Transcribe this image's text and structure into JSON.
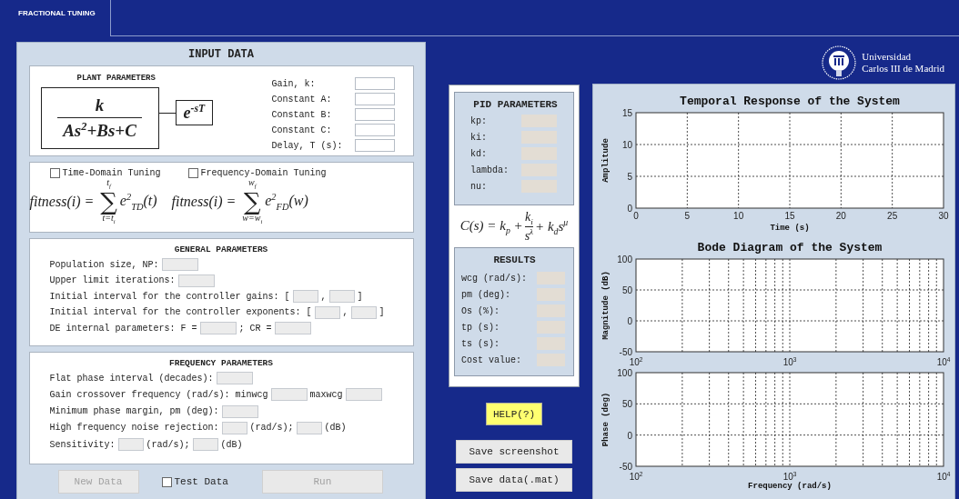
{
  "tab": {
    "label": "FRACTIONAL TUNING",
    "selected": true
  },
  "input_data": {
    "title": "INPUT DATA",
    "plant_parameters": {
      "title": "PLANT PARAMETERS",
      "numerator": "k",
      "denominator": "As$^{2}$+Bs+C",
      "delay": "e$^{-sT}$",
      "fields": [
        {
          "label": "Gain, k:",
          "disabled": false
        },
        {
          "label": "Constant A:",
          "disabled": false
        },
        {
          "label": "Constant B:",
          "disabled": false
        },
        {
          "label": "Constant C:",
          "disabled": false
        },
        {
          "label": "Delay, T (s):",
          "disabled": false
        }
      ]
    },
    "tuning": [
      {
        "label": "Time-Domain Tuning",
        "checked": false,
        "formula": {
          "lhs": "fitness(i) =",
          "upper": "t$_{f}$",
          "sum": "∑",
          "lower": "t=t$_{i}$",
          "term": "e$^{2}$$_{TD}$(t)"
        }
      },
      {
        "label": "Frequency-Domain Tuning",
        "checked": false,
        "formula": {
          "lhs": "fitness(i) =",
          "upper": "w$_{f}$",
          "sum": "∑",
          "lower": "w=w$_{i}$",
          "term": "e$^{2}$$_{FD}$(w)"
        }
      }
    ],
    "general_parameters": {
      "title": "GENERAL PARAMETERS",
      "rows": [
        {
          "items": [
            {
              "kind": "text",
              "text": "Population size, NP:"
            },
            {
              "kind": "field",
              "disabled": true
            }
          ]
        },
        {
          "items": [
            {
              "kind": "text",
              "text": "Upper limit iterations:"
            },
            {
              "kind": "field",
              "disabled": true
            }
          ]
        },
        {
          "items": [
            {
              "kind": "text",
              "text": "Initial interval for the controller gains: ["
            },
            {
              "kind": "field",
              "disabled": true
            },
            {
              "kind": "text",
              "text": ","
            },
            {
              "kind": "field",
              "disabled": true
            },
            {
              "kind": "text",
              "text": "]"
            }
          ]
        },
        {
          "items": [
            {
              "kind": "text",
              "text": "Initial interval for the controller exponents: ["
            },
            {
              "kind": "field",
              "disabled": true
            },
            {
              "kind": "text",
              "text": ","
            },
            {
              "kind": "field",
              "disabled": true
            },
            {
              "kind": "text",
              "text": "]"
            }
          ]
        },
        {
          "items": [
            {
              "kind": "text",
              "text": "DE internal parameters: F ="
            },
            {
              "kind": "field",
              "disabled": true
            },
            {
              "kind": "text",
              "text": "; CR ="
            },
            {
              "kind": "field",
              "disabled": true
            }
          ]
        }
      ]
    },
    "frequency_parameters": {
      "title": "FREQUENCY PARAMETERS",
      "rows": [
        {
          "items": [
            {
              "kind": "text",
              "text": "Flat phase interval (decades):"
            },
            {
              "kind": "field",
              "disabled": true
            }
          ]
        },
        {
          "items": [
            {
              "kind": "text",
              "text": "Gain crossover frequency (rad/s): minwcg"
            },
            {
              "kind": "field",
              "disabled": true
            },
            {
              "kind": "text",
              "text": "maxwcg"
            },
            {
              "kind": "field",
              "disabled": true
            }
          ]
        },
        {
          "items": [
            {
              "kind": "text",
              "text": "Minimum phase margin, pm (deg):"
            },
            {
              "kind": "field",
              "disabled": true
            }
          ]
        },
        {
          "items": [
            {
              "kind": "text",
              "text": "High frequency noise rejection:"
            },
            {
              "kind": "field",
              "disabled": true
            },
            {
              "kind": "text",
              "text": "(rad/s);"
            },
            {
              "kind": "field",
              "disabled": true
            },
            {
              "kind": "text",
              "text": "(dB)"
            }
          ]
        },
        {
          "items": [
            {
              "kind": "text",
              "text": "Sensitivity:"
            },
            {
              "kind": "field",
              "disabled": true
            },
            {
              "kind": "text",
              "text": "(rad/s);"
            },
            {
              "kind": "field",
              "disabled": true
            },
            {
              "kind": "text",
              "text": "(dB)"
            }
          ]
        }
      ]
    },
    "controls": [
      {
        "kind": "button",
        "label": "New Data",
        "disabled": true
      },
      {
        "kind": "checkbox",
        "label": "Test Data",
        "checked": false
      },
      {
        "kind": "button",
        "label": "Run",
        "disabled": true
      }
    ]
  },
  "pid_parameters": {
    "title": "PID PARAMETERS",
    "rows": [
      {
        "label": "kp:"
      },
      {
        "label": "ki:"
      },
      {
        "label": "kd:"
      },
      {
        "label": "lambda:"
      },
      {
        "label": "nu:"
      }
    ]
  },
  "controller_formula": {
    "lhs": "C(s) = k$_{p}$ +",
    "numerator": "k$_{i}$",
    "denominator": "s$^{λ}$",
    "rhs": "+ k$_{d}$s$^{μ}$"
  },
  "results": {
    "title": "RESULTS",
    "rows": [
      {
        "label": "wcg (rad/s):"
      },
      {
        "label": "pm (deg):"
      },
      {
        "label": "Os (%):"
      },
      {
        "label": "tp (s):"
      },
      {
        "label": "ts (s):"
      },
      {
        "label": "Cost value:"
      }
    ]
  },
  "help_button": {
    "label": "HELP(?)"
  },
  "save_buttons": [
    "Save screenshot",
    "Save data(.mat)"
  ],
  "logo": {
    "line_1": "Universidad",
    "line_2": "Carlos III de Madrid"
  },
  "charts": [
    {
      "chart_data": {
        "type": "line",
        "title": "Temporal Response of the System",
        "xlabel": "Time (s)",
        "ylabel": "Amplitude",
        "grid": true,
        "xlim": [
          0,
          30
        ],
        "ylim": [
          0,
          15
        ],
        "xticks": [
          0,
          5,
          10,
          15,
          20,
          25,
          30
        ],
        "yticks": [
          0,
          5,
          10,
          15
        ]
      }
    },
    {
      "chart_data": {
        "type": "line",
        "title": "Bode Diagram of the System",
        "ylabel": "Magnitude (dB)",
        "grid": "minor",
        "categories": [
          "10$^{2}$",
          "10$^{3}$",
          "10$^{4}$"
        ],
        "ylim": [
          -50,
          100
        ],
        "yticks": [
          -50,
          0,
          50,
          100
        ]
      }
    },
    {
      "chart_data": {
        "type": "line",
        "xlabel": "Frequency (rad/s)",
        "ylabel": "Phase (deg)",
        "grid": "minor",
        "categories": [
          "10$^{2}$",
          "10$^{3}$",
          "10$^{4}$"
        ],
        "ylim": [
          -50,
          100
        ],
        "yticks": [
          -50,
          0,
          50,
          100
        ]
      }
    }
  ]
}
